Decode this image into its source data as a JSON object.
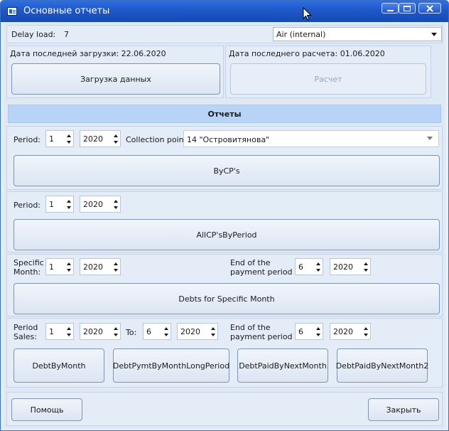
{
  "window": {
    "title": "Основные отчеты"
  },
  "top": {
    "delay_label": "Delay load:",
    "delay_value": "7",
    "source_select": "Air (internal)"
  },
  "load": {
    "date_label": "Дата последней загрузки: 22.06.2020",
    "button": "Загрузка данных"
  },
  "calc": {
    "date_label": "Дата последнего расчета: 01.06.2020",
    "button": "Расчет"
  },
  "reports_header": "Отчеты",
  "section1": {
    "period_label": "Period:",
    "period_month": "1",
    "period_year": "2020",
    "cp_label": "Collection point",
    "cp_value": "14 \"Островитянова\"",
    "button": "ByCP's"
  },
  "section2": {
    "period_label": "Period:",
    "period_month": "1",
    "period_year": "2020",
    "button": "AllCP'sByPeriod"
  },
  "section3": {
    "specific_label_1": "Specific",
    "specific_label_2": "Month:",
    "month": "1",
    "year": "2020",
    "end_label_1": "End of the",
    "end_label_2": "payment period",
    "end_month": "6",
    "end_year": "2020",
    "button": "Debts for Specific Month"
  },
  "section4": {
    "period_label_1": "Period",
    "period_label_2": "Sales:",
    "from_month": "1",
    "from_year": "2020",
    "to_label": "To:",
    "to_month": "6",
    "to_year": "2020",
    "end_label_1": "End of the",
    "end_label_2": "payment period",
    "end_month": "6",
    "end_year": "2020",
    "buttons": [
      "DebtByMonth",
      "DebtPymtByMonthLongPeriod",
      "DebtPaidByNextMonth",
      "DebtPaidByNextMonth2"
    ]
  },
  "footer": {
    "help": "Помощь",
    "close": "Закрыть"
  }
}
